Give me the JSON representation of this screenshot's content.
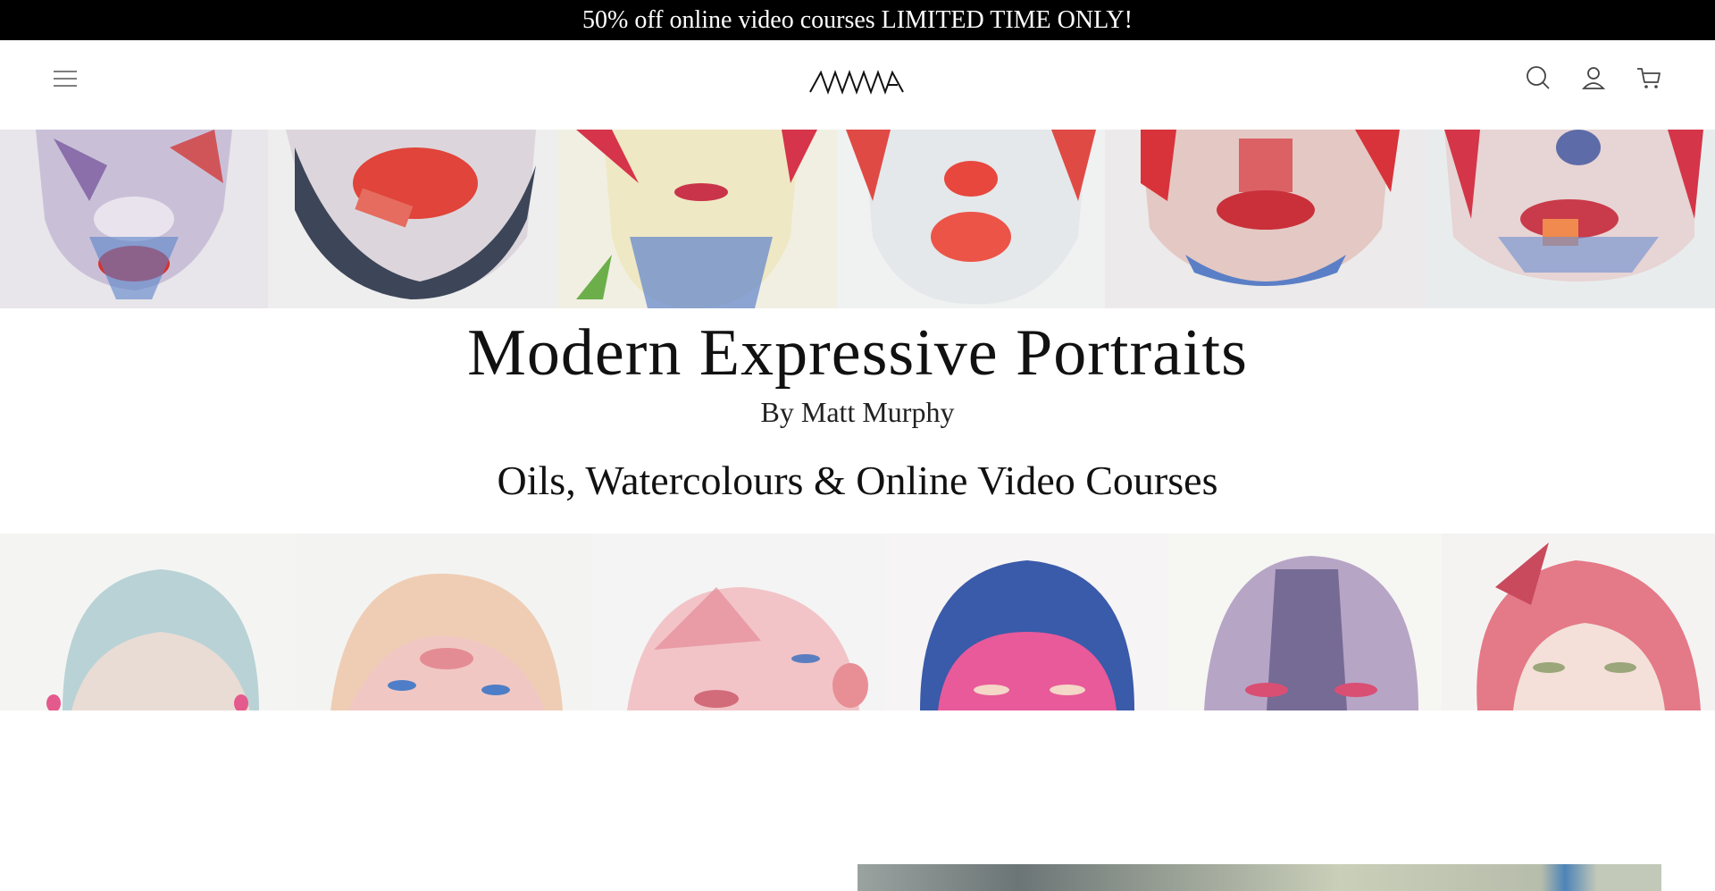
{
  "announcement": {
    "text": "50% off online video courses LIMITED TIME ONLY!"
  },
  "header": {
    "logo_text": "MMA",
    "icons": [
      "menu-icon",
      "search-icon",
      "account-icon",
      "cart-icon"
    ]
  },
  "hero": {
    "title": "Modern Expressive Portraits",
    "byline": "By Matt Murphy",
    "subtitle": "Oils, Watercolours & Online Video Courses"
  },
  "colors": {
    "announcement_bg": "#000000",
    "announcement_text": "#ffffff",
    "accent_red": "#e0483c",
    "accent_blue": "#4a78c0"
  }
}
